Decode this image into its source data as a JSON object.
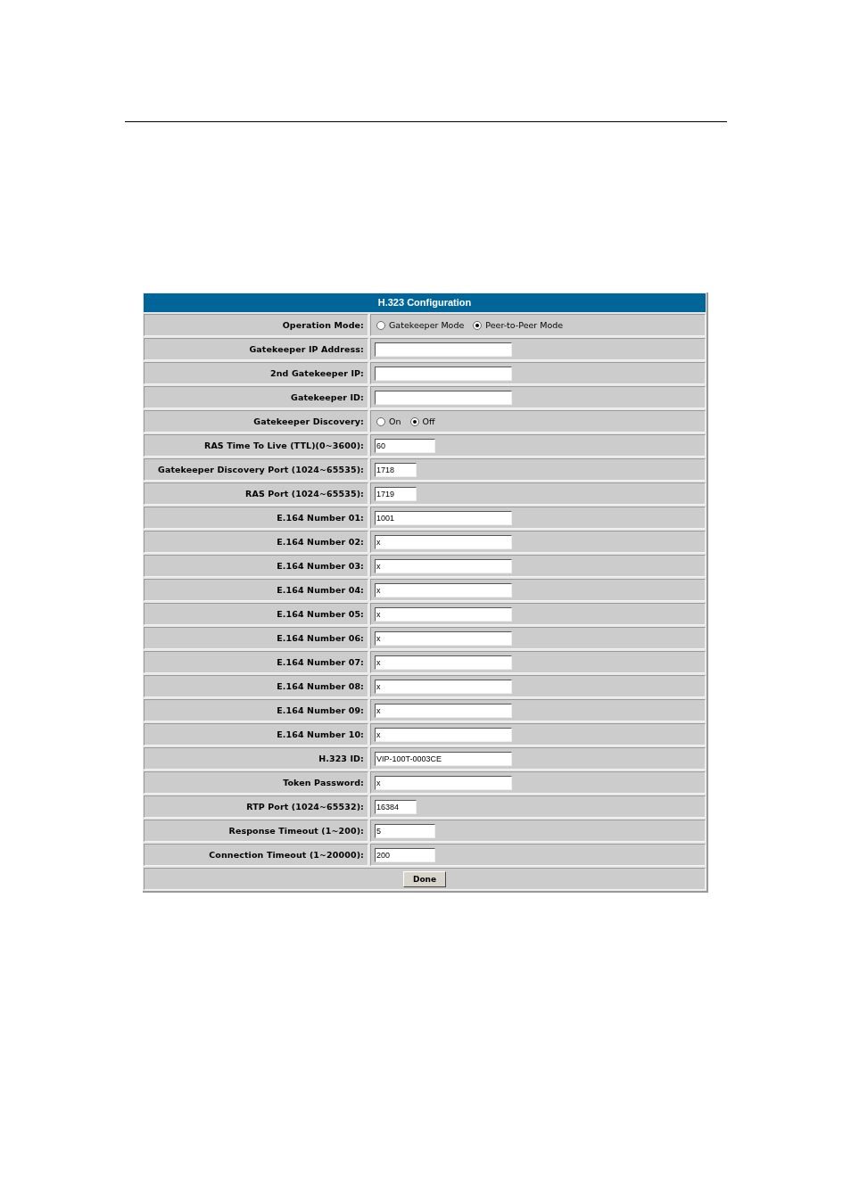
{
  "form": {
    "title": "H.323 Configuration",
    "rows": [
      {
        "label": "Operation Mode:",
        "kind": "radio",
        "options": [
          {
            "label": "Gatekeeper Mode",
            "selected": false
          },
          {
            "label": "Peer-to-Peer Mode",
            "selected": true
          }
        ]
      },
      {
        "label": "Gatekeeper IP Address:",
        "kind": "text",
        "value": ""
      },
      {
        "label": "2nd Gatekeeper IP:",
        "kind": "text",
        "value": ""
      },
      {
        "label": "Gatekeeper ID:",
        "kind": "text",
        "value": ""
      },
      {
        "label": "Gatekeeper Discovery:",
        "kind": "radio",
        "options": [
          {
            "label": "On",
            "selected": false
          },
          {
            "label": "Off",
            "selected": true
          }
        ]
      },
      {
        "label": "RAS Time To Live (TTL)(0~3600):",
        "kind": "number",
        "value": "60"
      },
      {
        "label": "Gatekeeper Discovery Port (1024~65535):",
        "kind": "port",
        "value": "1718"
      },
      {
        "label": "RAS Port (1024~65535):",
        "kind": "port",
        "value": "1719"
      },
      {
        "label": "E.164 Number 01:",
        "kind": "text",
        "value": "1001"
      },
      {
        "label": "E.164 Number 02:",
        "kind": "text",
        "value": "x"
      },
      {
        "label": "E.164 Number 03:",
        "kind": "text",
        "value": "x"
      },
      {
        "label": "E.164 Number 04:",
        "kind": "text",
        "value": "x"
      },
      {
        "label": "E.164 Number 05:",
        "kind": "text",
        "value": "x"
      },
      {
        "label": "E.164 Number 06:",
        "kind": "text",
        "value": "x"
      },
      {
        "label": "E.164 Number 07:",
        "kind": "text",
        "value": "x"
      },
      {
        "label": "E.164 Number 08:",
        "kind": "text",
        "value": "x"
      },
      {
        "label": "E.164 Number 09:",
        "kind": "text",
        "value": "x"
      },
      {
        "label": "E.164 Number 10:",
        "kind": "text",
        "value": "x"
      },
      {
        "label": "H.323 ID:",
        "kind": "text",
        "value": "VIP-100T-0003CE"
      },
      {
        "label": "Token Password:",
        "kind": "text",
        "value": "x"
      },
      {
        "label": "RTP Port (1024~65532):",
        "kind": "port",
        "value": "16384"
      },
      {
        "label": "Response Timeout (1~200):",
        "kind": "number",
        "value": "5"
      },
      {
        "label": "Connection Timeout (1~20000):",
        "kind": "number",
        "value": "200"
      }
    ],
    "button": "Done"
  }
}
